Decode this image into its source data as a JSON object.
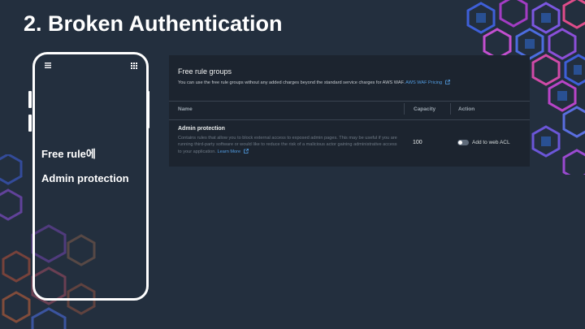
{
  "slide": {
    "title": "2. Broken Authentication"
  },
  "phone": {
    "menu_icon": "hamburger-menu-icon",
    "grid_icon": "grid-icon",
    "text_line1": "Free rule에",
    "text_line2": "Admin protection"
  },
  "panel": {
    "title": "Free rule groups",
    "description": "You can use the free rule groups without any added charges beyond the standard service charges for AWS WAF.",
    "pricing_link": "AWS WAF Pricing",
    "columns": {
      "name": "Name",
      "capacity": "Capacity",
      "action": "Action"
    },
    "row": {
      "name": "Admin protection",
      "description": "Contains rules that allow you to block external access to exposed admin pages. This may be useful if you are running third-party software or would like to reduce the risk of a malicious actor gaining administrative access to your application.",
      "learn_more": "Learn More",
      "capacity": "100",
      "toggle_label": "Add to web ACL",
      "toggle_on": false
    }
  },
  "colors": {
    "background": "#232f3e",
    "panel": "#1c242f",
    "link": "#539fe5"
  }
}
